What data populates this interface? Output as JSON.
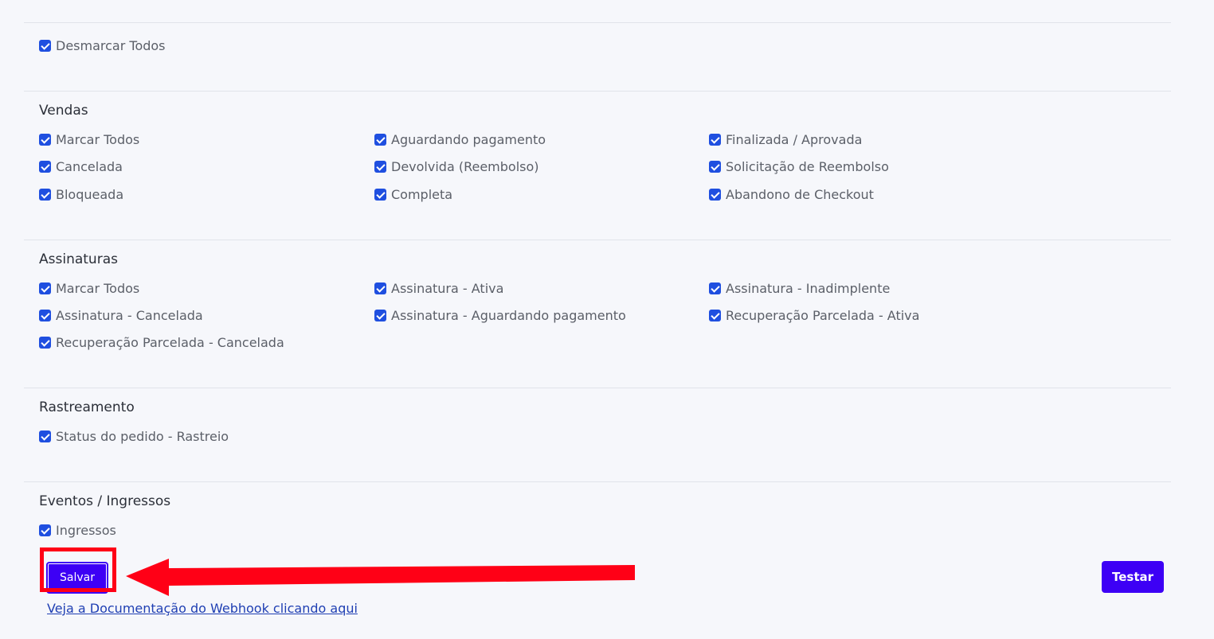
{
  "sections": {
    "unselect": {
      "items": [
        "Desmarcar Todos"
      ]
    },
    "vendas": {
      "title": "Vendas",
      "items": [
        "Marcar Todos",
        "Aguardando pagamento",
        "Finalizada / Aprovada",
        "Cancelada",
        "Devolvida (Reembolso)",
        "Solicitação de Reembolso",
        "Bloqueada",
        "Completa",
        "Abandono de Checkout"
      ]
    },
    "assinaturas": {
      "title": "Assinaturas",
      "items": [
        "Marcar Todos",
        "Assinatura - Ativa",
        "Assinatura - Inadimplente",
        "Assinatura - Cancelada",
        "Assinatura - Aguardando pagamento",
        "Recuperação Parcelada - Ativa",
        "Recuperação Parcelada - Cancelada"
      ]
    },
    "rastreamento": {
      "title": "Rastreamento",
      "items": [
        "Status do pedido - Rastreio"
      ]
    },
    "eventos": {
      "title": "Eventos / Ingressos",
      "items": [
        "Ingressos"
      ]
    }
  },
  "actions": {
    "save_label": "Salvar",
    "test_label": "Testar",
    "doc_link": "Veja a Documentação do Webhook clicando aqui"
  },
  "colors": {
    "primary_button": "#3d00f5",
    "checkbox": "#1f4fe0",
    "annotation_red": "#ff0016",
    "link": "#1f3fb3"
  }
}
